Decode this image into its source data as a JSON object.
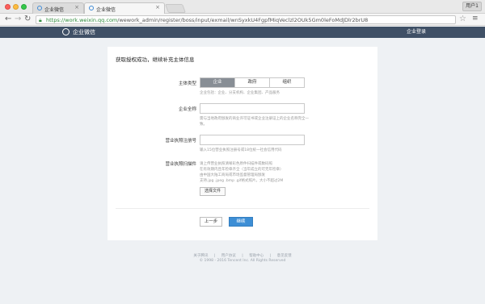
{
  "browser": {
    "tabs": [
      {
        "title": "企业微信"
      },
      {
        "title": "企业微信"
      }
    ],
    "user_button": "用户1",
    "url_host": "https://work.weixin.qq.com",
    "url_path": "/wework_admin/register/boss/input/exmail/wnSyxkU4FgpfMiqVeclzl2OUk5Gm0leFoMdJDlr2brU8"
  },
  "header": {
    "logo_text": "企业微信",
    "right_link": "企业登录"
  },
  "form": {
    "title": "获取授权成功，继续补充主体信息",
    "entity_type": {
      "label": "主体类型",
      "options": [
        "企业",
        "政府",
        "组织"
      ],
      "selected": "企业",
      "hint": "企业包括：企业、分支机构、企业集团、产品服务"
    },
    "company_name": {
      "label": "企业全称",
      "value": "",
      "hint": "需与当地政府颁发的商业许可证书或企业注册证上的企业名称完全一致。"
    },
    "license_number": {
      "label": "营业执照注册号",
      "value": "",
      "hint": "输入15位营业执照注册号或18位统一社会信用代码"
    },
    "license_scan": {
      "label": "营业执照扫描件",
      "hints": [
        "请上传营业执照清晰彩色原件扫描件或数码照",
        "在有效期内且年检章齐全（当年成立的可无年检章）",
        "由中国大陆工商局或市场监督管理局颁发",
        "支持.jpg .jpeg .bmp .gif格式照片，大小不超过2M"
      ],
      "button": "选择文件"
    },
    "prev_button": "上一步",
    "next_button": "继续"
  },
  "footer": {
    "links": [
      "关于腾讯",
      "|",
      "用户协议",
      "|",
      "帮助中心",
      "|",
      "意见反馈"
    ],
    "copyright": "© 1998 - 2016 Tencent Inc. All Rights Reserved"
  }
}
